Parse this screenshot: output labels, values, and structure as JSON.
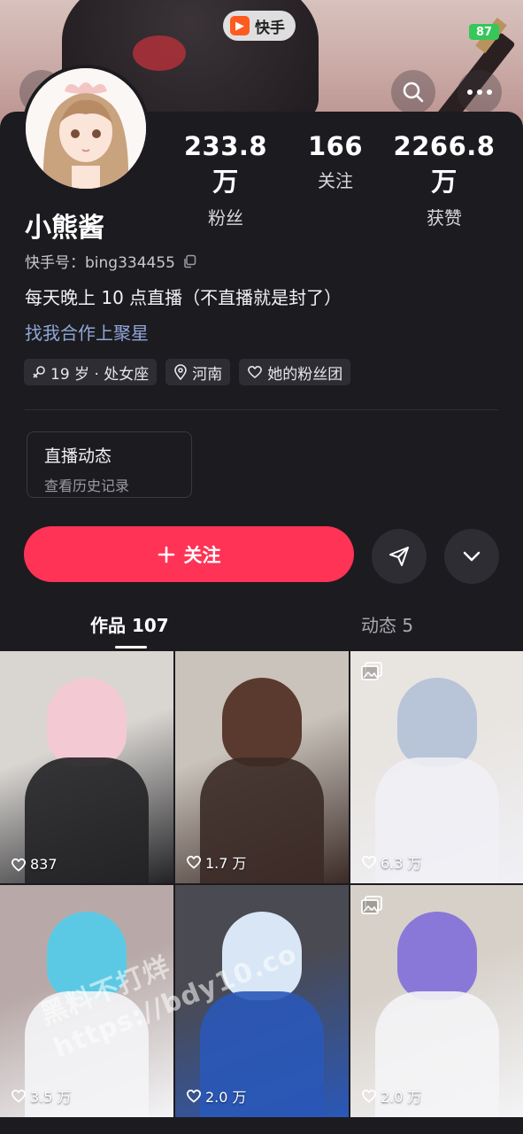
{
  "app": {
    "name": "快手",
    "battery": "87"
  },
  "profile": {
    "name": "小熊酱",
    "uid_label": "快手号：bing334455",
    "bio": "每天晚上 10 点直播（不直播就是封了）",
    "link": "找我合作上聚星"
  },
  "stats": {
    "fans_value": "233.8 万",
    "fans_label": "粉丝",
    "follow_value": "166",
    "follow_label": "关注",
    "likes_value": "2266.8 万",
    "likes_label": "获赞"
  },
  "tags": [
    {
      "icon": "female-icon",
      "label": "19 岁 · 处女座"
    },
    {
      "icon": "location-icon",
      "label": "河南"
    },
    {
      "icon": "heart-icon",
      "label": "她的粉丝团"
    }
  ],
  "live_card": {
    "title": "直播动态",
    "subtitle": "查看历史记录"
  },
  "actions": {
    "follow_label": "关注"
  },
  "tabs": [
    {
      "label": "作品 107",
      "active": true
    },
    {
      "label": "动态 5",
      "active": false
    }
  ],
  "works": [
    {
      "likes": "837",
      "gallery": false,
      "colors": [
        "#d9d6d2",
        "#f3c9d4",
        "#222226"
      ]
    },
    {
      "likes": "1.7 万",
      "gallery": false,
      "colors": [
        "#c9c3bb",
        "#5a3a2e",
        "#3b2a26"
      ]
    },
    {
      "likes": "6.3 万",
      "gallery": true,
      "colors": [
        "#e8e4e0",
        "#b8c4d8",
        "#f0f0f5"
      ]
    },
    {
      "likes": "3.5 万",
      "gallery": false,
      "colors": [
        "#b8a9a8",
        "#5cc9e4",
        "#f4f4f6"
      ]
    },
    {
      "likes": "2.0 万",
      "gallery": false,
      "colors": [
        "#4a4a52",
        "#d8e6f5",
        "#2a58b8"
      ]
    },
    {
      "likes": "2.0 万",
      "gallery": true,
      "colors": [
        "#d6d0c8",
        "#8a78d8",
        "#f4f4f6"
      ]
    }
  ],
  "watermark": {
    "line1": "黑料不打烊",
    "line2": "https://bdy10.co"
  },
  "colors": {
    "accent": "#fe3355",
    "link": "#8fa6d6",
    "background": "#1c1b20"
  }
}
